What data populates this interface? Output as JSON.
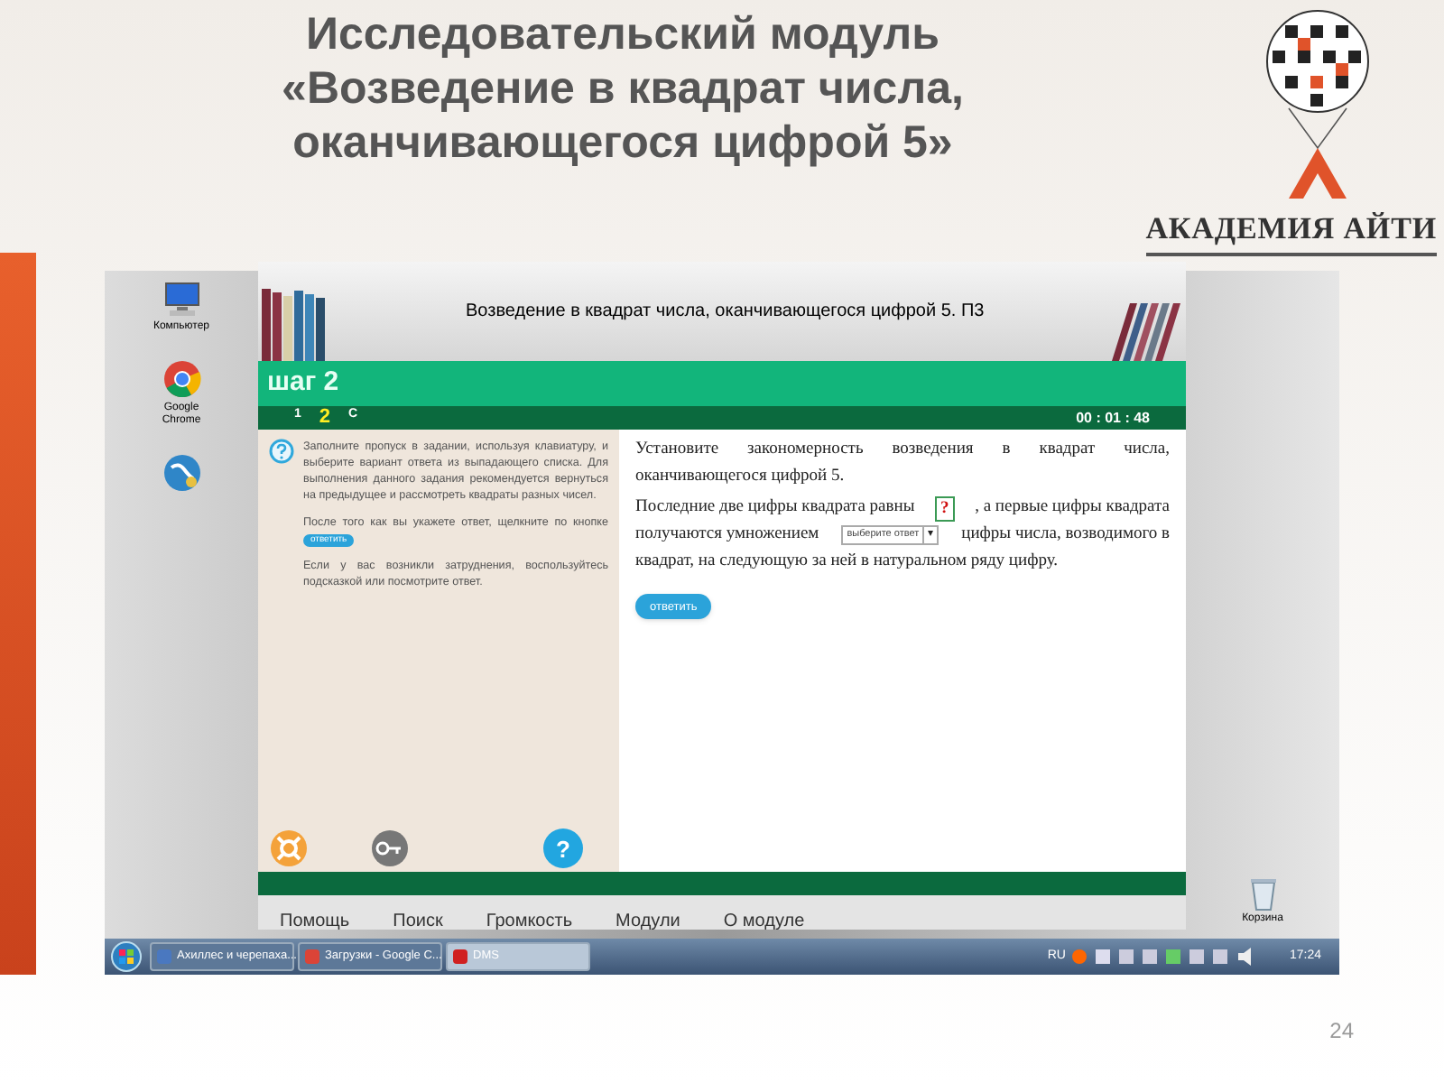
{
  "slide": {
    "title": "Исследовательский модуль «Возведение в квадрат числа, оканчивающегося цифрой 5»",
    "logo_text": "АКАДЕМИЯ АЙТИ",
    "page_number": "24"
  },
  "desktop": {
    "icons": [
      {
        "kind": "computer",
        "label": "Компьютер"
      },
      {
        "kind": "chrome",
        "label": "Google Chrome"
      },
      {
        "kind": "globe"
      }
    ],
    "recycle_bin": {
      "label": "Корзина"
    }
  },
  "app": {
    "title": "Возведение в квадрат числа, оканчивающегося цифрой 5. П3",
    "step_title": "шаг 2",
    "steps": [
      {
        "label": "1",
        "selected": false
      },
      {
        "label": "2",
        "selected": true
      },
      {
        "label": "С",
        "selected": false
      }
    ],
    "timer": "00 : 01 : 48",
    "help": [
      {
        "text": "Заполните пропуск в задании, используя клавиатуру, и выберите вариант ответа из выпадающего списка. Для выполнения данного задания рекомендуется вернуться на предыдущее и рассмотреть квадраты разных чисел."
      },
      {
        "text": "После того как вы укажете ответ, щелкните по кнопке",
        "button": "ответить"
      },
      {
        "text": "Если у вас возникли затруднения, воспользуйтесь подсказкой или посмотрите ответ."
      }
    ],
    "task_intro": "Установите закономерность возведения в квадрат числа, оканчивающегося цифрой 5.",
    "task_lines": [
      [
        {
          "kind": "text",
          "text": "Последние две цифры квадрата равны"
        },
        {
          "kind": "blank",
          "text": "?"
        },
        {
          "kind": "text",
          "text": ", а первые цифры квадрата"
        }
      ],
      [
        {
          "kind": "text",
          "text": "получаются умножением"
        },
        {
          "kind": "dropdown",
          "placeholder": "выберите ответ",
          "arrow": "▾"
        },
        {
          "kind": "text",
          "text": "цифры числа, возводимого в"
        }
      ],
      [
        {
          "kind": "text",
          "text": "квадрат, на следующую за ней в натуральном ряду цифру."
        }
      ]
    ],
    "submit": "ответить",
    "help_button": "?",
    "menu": [
      "Помощь",
      "Поиск",
      "Громкость",
      "Модули",
      "О модуле"
    ]
  },
  "taskbar": {
    "tasks": [
      {
        "label": "Ахиллес и черепаха...",
        "kind": "doc",
        "selected": false
      },
      {
        "label": "Загрузки - Google C...",
        "kind": "chrome",
        "selected": false
      },
      {
        "label": "DMS",
        "kind": "flash",
        "selected": true
      }
    ],
    "language": "RU",
    "clock": "17:24"
  }
}
